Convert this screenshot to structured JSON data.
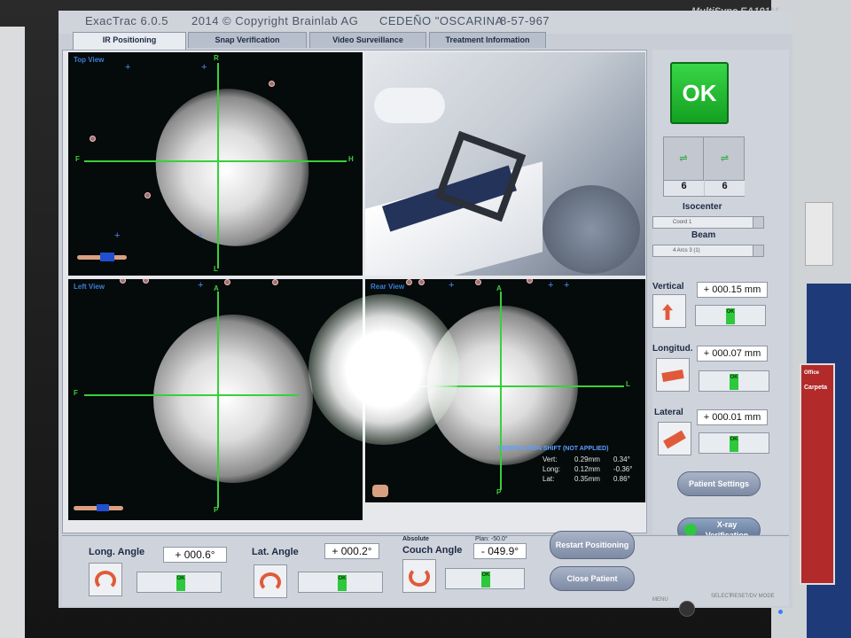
{
  "window": {
    "title": "ExacTrac 6.0.5",
    "copyright": "2014 © Copyright Brainlab AG",
    "patient_name": "CEDEÑO \"OSCARINA",
    "patient_id": "8-57-967",
    "monitor_brand": "MultiSync EA191M"
  },
  "tabs": [
    {
      "label": "IR Positioning",
      "active": true
    },
    {
      "label": "Snap Verification",
      "active": false
    },
    {
      "label": "Video Surveillance",
      "active": false
    },
    {
      "label": "Treatment Information",
      "active": false
    }
  ],
  "views": {
    "top": {
      "label": "Top View",
      "axis_top": "R",
      "axis_bottom": "L",
      "axis_left": "F",
      "axis_right": "H"
    },
    "left": {
      "label": "Left View",
      "axis_top": "A",
      "axis_bottom": "P",
      "axis_left": "F"
    },
    "rear": {
      "label": "Rear View",
      "axis_top": "A",
      "axis_bottom": "P",
      "axis_right": "L"
    }
  },
  "verification_shift": {
    "title": "VERIFICATION SHIFT (NOT APPLIED)",
    "rows": [
      {
        "label": "Vert:",
        "mm": "0.29mm",
        "deg": "0.34°"
      },
      {
        "label": "Long:",
        "mm": "0.12mm",
        "deg": "-0.36°"
      },
      {
        "label": "Lat:",
        "mm": "0.35mm",
        "deg": "0.86°"
      }
    ]
  },
  "right": {
    "ok_label": "OK",
    "camera_counts": [
      "6",
      "6"
    ],
    "isocenter_title": "Isocenter",
    "isocenter_value": "Coord 1",
    "beam_title": "Beam",
    "beam_value": "4 Arcs 3 (1)",
    "vertical": {
      "label": "Vertical",
      "value": "+ 000.15 mm",
      "status": "OK"
    },
    "longitud": {
      "label": "Longitud.",
      "value": "+ 000.07 mm",
      "status": "OK"
    },
    "lateral": {
      "label": "Lateral",
      "value": "+ 000.01 mm",
      "status": "OK"
    },
    "patient_settings": "Patient Settings",
    "xray_verification": "X-ray Verification"
  },
  "bottom": {
    "long_angle": {
      "label": "Long. Angle",
      "value": "+ 000.6°",
      "status": "OK"
    },
    "lat_angle": {
      "label": "Lat. Angle",
      "value": "+ 000.2°",
      "status": "OK"
    },
    "couch_angle": {
      "label_top": "Absolute",
      "label": "Couch Angle",
      "plan": "Plan: -50.0°",
      "value": "- 049.9°",
      "status": "OK"
    },
    "restart_positioning": "Restart Positioning",
    "close_patient": "Close Patient"
  },
  "monitor_controls": [
    "MENU",
    "SELECT",
    "RESET/DV MODE"
  ],
  "binder": {
    "brand": "Office",
    "title": "Carpeta"
  }
}
